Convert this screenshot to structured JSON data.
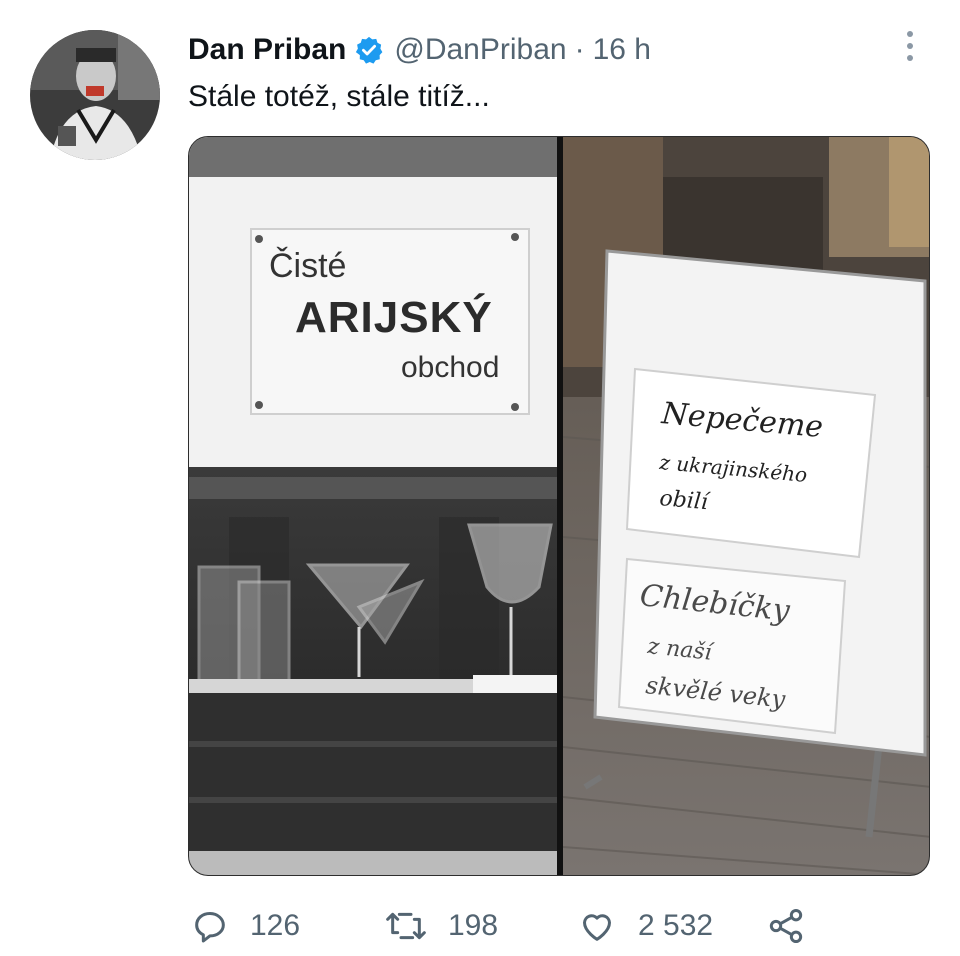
{
  "tweet": {
    "author_name": "Dan Priban",
    "verified": true,
    "handle": "@DanPriban",
    "separator": "·",
    "time": "16 h",
    "text": "Stále totéž, stále titíž...",
    "media": {
      "left_panel": {
        "sign_line1": "Čisté",
        "sign_line2": "ARIJSKÝ",
        "sign_line3": "obchod"
      },
      "right_panel": {
        "note1_line1": "Nepečeme",
        "note1_line2": "z ukrajinského",
        "note1_line3": "obilí",
        "note2_line1": "Chlebíčky",
        "note2_line2": "z naší",
        "note2_line3": "skvělé veky"
      }
    },
    "stats": {
      "replies": "126",
      "retweets": "198",
      "likes": "2 532"
    }
  },
  "colors": {
    "verified": "#1d9bf0",
    "text_primary": "#0f1419",
    "text_secondary": "#536471"
  },
  "icons": [
    "verified-badge-icon",
    "more-options-icon",
    "reply-icon",
    "retweet-icon",
    "like-icon",
    "share-icon"
  ]
}
